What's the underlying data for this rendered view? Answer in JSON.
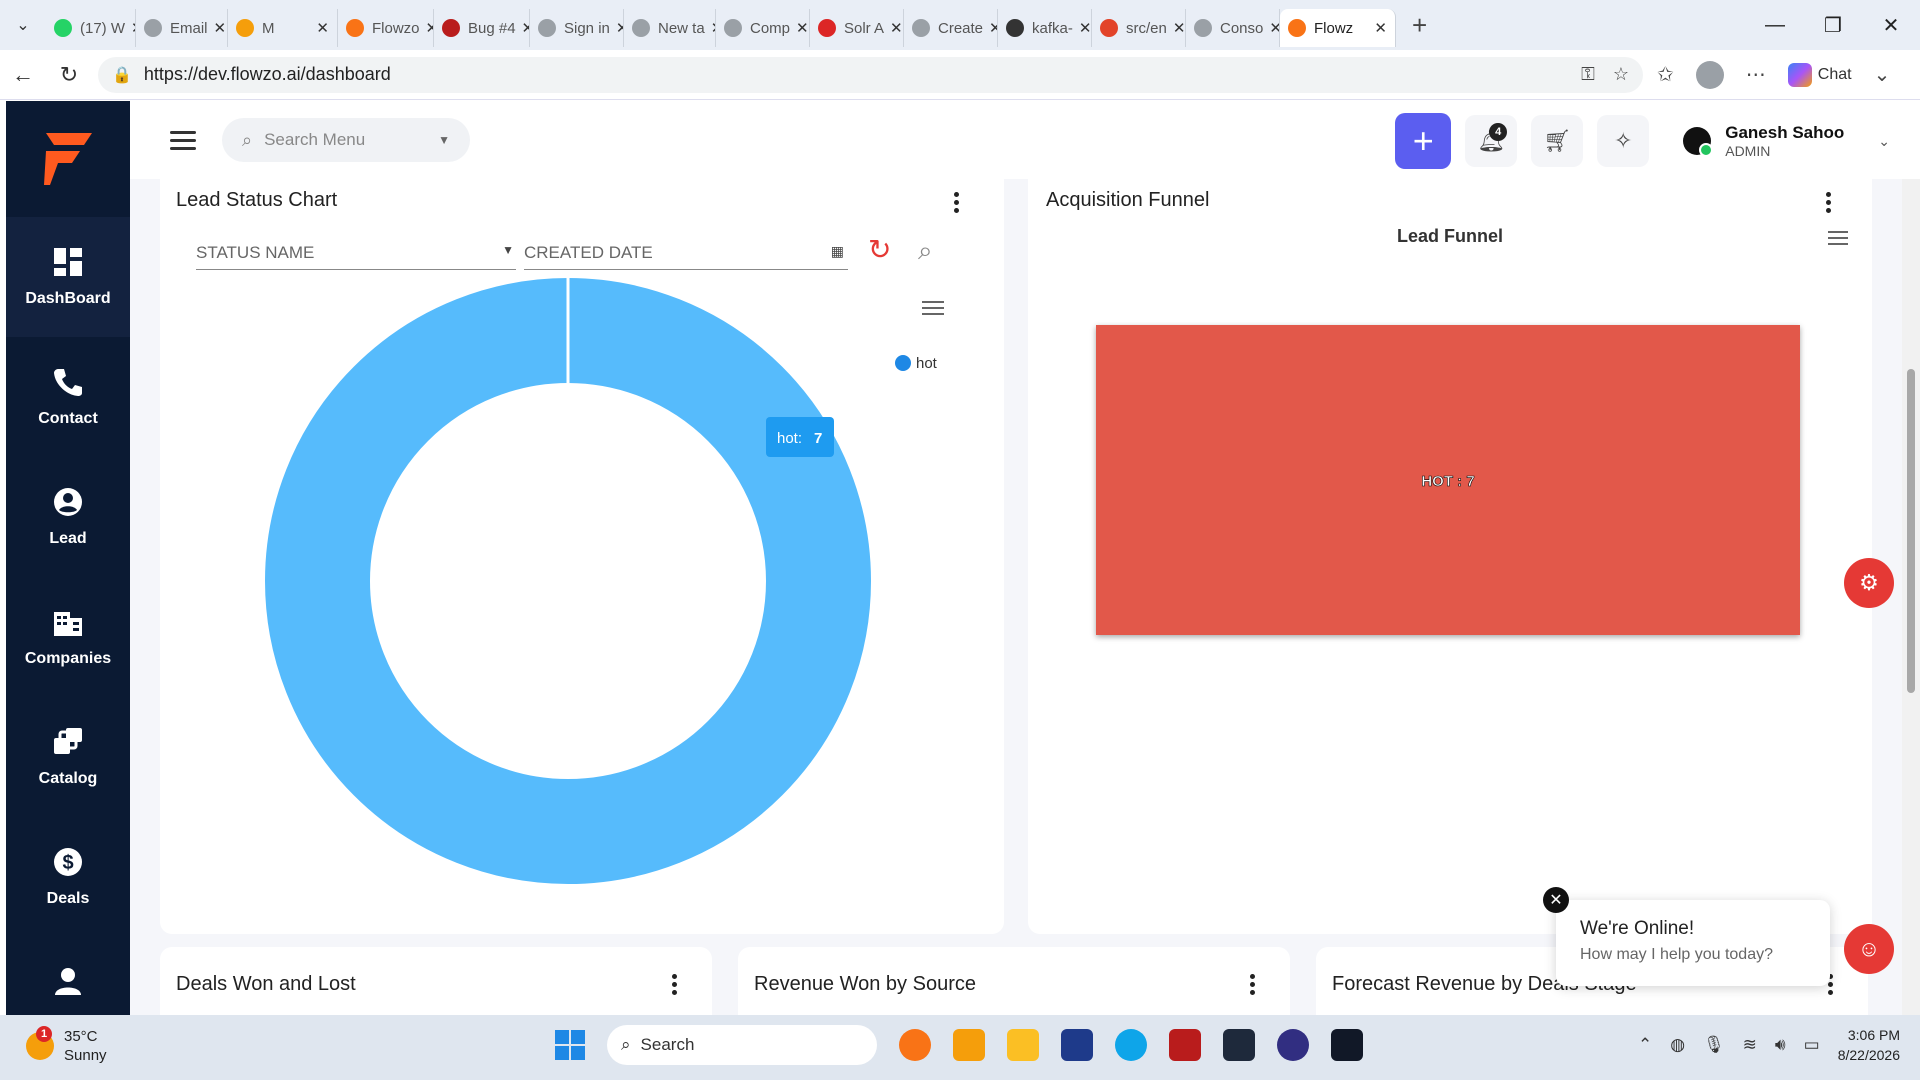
{
  "browser": {
    "tabs": [
      {
        "label": "(17) W",
        "color": "#25d366"
      },
      {
        "label": "Email",
        "color": "#9aa0a6"
      },
      {
        "label": "M",
        "color": "#f59e0b"
      },
      {
        "label": "Flowzo",
        "color": "#f97316"
      },
      {
        "label": "Bug #4",
        "color": "#b91c1c"
      },
      {
        "label": "Sign in",
        "color": "#9aa0a6"
      },
      {
        "label": "New ta",
        "color": "#9aa0a6"
      },
      {
        "label": "Comp",
        "color": "#9aa0a6"
      },
      {
        "label": "Solr A",
        "color": "#dc2626"
      },
      {
        "label": "Create",
        "color": "#9aa0a6"
      },
      {
        "label": "kafka-",
        "color": "#333333"
      },
      {
        "label": "src/en",
        "color": "#e24329"
      },
      {
        "label": "Conso",
        "color": "#9aa0a6"
      },
      {
        "label": "Flowz",
        "color": "#f97316"
      }
    ],
    "url": "https://dev.flowzo.ai/dashboard",
    "chat_label": "Chat"
  },
  "sidebar": {
    "items": [
      {
        "label": "DashBoard",
        "icon": "dashboard-icon"
      },
      {
        "label": "Contact",
        "icon": "phone-icon"
      },
      {
        "label": "Lead",
        "icon": "account-circle-icon"
      },
      {
        "label": "Companies",
        "icon": "companies-icon"
      },
      {
        "label": "Catalog",
        "icon": "catalog-icon"
      },
      {
        "label": "Deals",
        "icon": "dollar-icon"
      },
      {
        "label": "",
        "icon": "user-icon"
      }
    ]
  },
  "topbar": {
    "search_placeholder": "Search Menu",
    "notification_count": "4",
    "user_name": "Ganesh Sahoo",
    "user_role": "ADMIN"
  },
  "lead_status": {
    "title": "Lead Status Chart",
    "filter_status": "STATUS NAME",
    "filter_date": "CREATED DATE",
    "legend": "hot",
    "tooltip_label": "hot:",
    "tooltip_value": "7"
  },
  "funnel": {
    "title": "Acquisition Funnel",
    "chart_title": "Lead Funnel",
    "bar_label": "HOT : 7"
  },
  "bottom_cards": {
    "deals": "Deals Won and Lost",
    "revenue": "Revenue Won by Source",
    "forecast": "Forecast Revenue by Deals Stage"
  },
  "chat": {
    "heading": "We're Online!",
    "sub": "How may I help you today?"
  },
  "taskbar": {
    "temp": "35°C",
    "weather": "Sunny",
    "weather_badge": "1",
    "search": "Search",
    "time": "3:06 PM",
    "date": "8/22/2026"
  },
  "chart_data": [
    {
      "type": "pie",
      "title": "Lead Status Chart",
      "categories": [
        "hot"
      ],
      "values": [
        7
      ],
      "legend_position": "top-right",
      "color": "#56bbfc"
    },
    {
      "type": "bar",
      "title": "Lead Funnel",
      "categories": [
        "HOT"
      ],
      "values": [
        7
      ],
      "color": "#e2584a"
    }
  ]
}
